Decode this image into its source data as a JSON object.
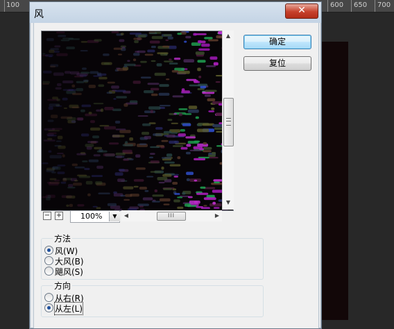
{
  "ruler": {
    "labels": [
      "100",
      "600",
      "650",
      "700"
    ]
  },
  "dialog": {
    "title": "风",
    "close_glyph": "✕",
    "buttons": {
      "ok": "确定",
      "reset": "复位"
    },
    "zoom": {
      "value": "100%"
    },
    "method": {
      "title": "方法",
      "options": [
        {
          "label": "风(W)",
          "selected": true
        },
        {
          "label": "大风(B)",
          "selected": false
        },
        {
          "label": "飓风(S)",
          "selected": false
        }
      ]
    },
    "direction": {
      "title": "方向",
      "options": [
        {
          "label": "从右(R)",
          "selected": false
        },
        {
          "label": "从左(L)",
          "selected": true
        }
      ]
    },
    "icons": {
      "zoom_out": "minus-icon",
      "zoom_in": "plus-icon",
      "dropdown": "chevron-down-icon",
      "scroll_up": "arrow-up-icon",
      "scroll_down": "arrow-down-icon",
      "scroll_left": "arrow-left-icon",
      "scroll_right": "arrow-right-icon"
    },
    "colors": {
      "title_bar": "#c9d8e8",
      "close_button": "#c6402b",
      "default_button_border": "#3c7fb1"
    }
  }
}
